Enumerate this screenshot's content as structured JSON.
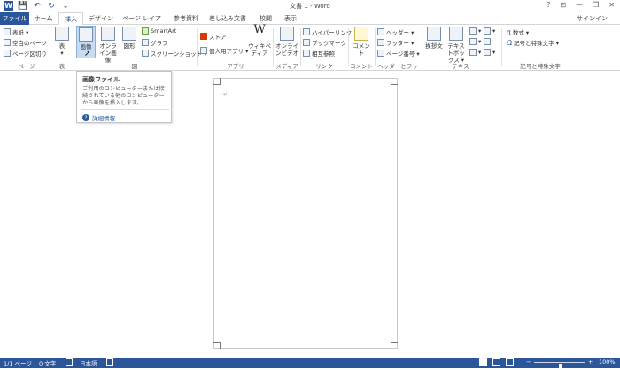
{
  "window": {
    "title": "文書 1 - Word",
    "signin": "サインイン"
  },
  "qat": {
    "logo": "W",
    "save": "💾",
    "undo": "↶",
    "redo": "↻",
    "more": "⌄"
  },
  "winctrl": {
    "help": "?",
    "ribbon_display": "⊡",
    "minimize": "—",
    "maximize": "❐",
    "close": "✕"
  },
  "tabs": [
    "ファイル",
    "ホーム",
    "挿入",
    "デザイン",
    "ページ レイアウト",
    "参考資料",
    "差し込み文書",
    "校閲",
    "表示"
  ],
  "ribbon": {
    "pages": {
      "items": [
        "表紙 ▾",
        "空白のページ",
        "ページ区切り"
      ],
      "label": "ページ"
    },
    "table": {
      "btn": "表",
      "label": "表"
    },
    "illust": {
      "picture": "画像",
      "online_pic": "オンライン画像",
      "shapes": "図形",
      "smartart": "SmartArt",
      "chart": "グラフ",
      "screenshot": "スクリーンショット ▾",
      "label": "図"
    },
    "apps": {
      "store": "ストア",
      "myapps": "個人用アプリ ▾",
      "wiki": "ウィキペディア",
      "label": "アプリ"
    },
    "media": {
      "video": "オンラインビデオ",
      "label": "メディア"
    },
    "links": {
      "hyperlink": "ハイパーリンク",
      "bookmark": "ブックマーク",
      "crossref": "相互参照",
      "label": "リンク"
    },
    "comments": {
      "comment": "コメント",
      "label": "コメント"
    },
    "headerfooter": {
      "header": "ヘッダー ▾",
      "footer": "フッター ▾",
      "pagenum": "ページ番号 ▾",
      "label": "ヘッダーとフッター"
    },
    "text": {
      "greeting": "挨拶文",
      "textbox": "テキストボックス ▾",
      "label": "テキスト"
    },
    "symbols": {
      "equation": "数式 ▾",
      "symbol": "記号と特殊文字 ▾",
      "label": "記号と特殊文字"
    },
    "collapse": "∧"
  },
  "tooltip": {
    "title": "画像ファイル",
    "desc": "ご利用のコンピューターまたは接続されている他のコンピューターから画像を挿入します。",
    "link": "詳細情報"
  },
  "document": {
    "pilcrow": "↵"
  },
  "status": {
    "page": "1/1 ページ",
    "words": "0 文字",
    "lang": "日本語",
    "zoom": "100%",
    "zoom_level": 0.5
  }
}
